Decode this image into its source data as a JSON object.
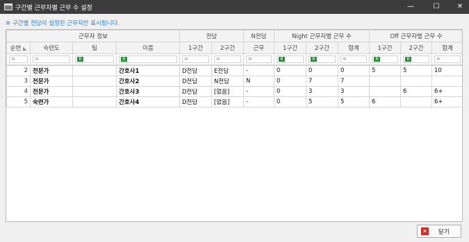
{
  "window": {
    "title": "구간별 근무자별 근무 수 설정",
    "min": "—",
    "max": "☐",
    "close": "✕"
  },
  "notice": "※ 구간별 전담이 설정된 근무자만 표시됩니다.",
  "groups": [
    "근무자 정보",
    "전담",
    "N전담",
    "Night 근무자별 근무 수",
    "Off 근무자별 근무 수"
  ],
  "columns": [
    "순번",
    "숙련도",
    "팀",
    "이름",
    "1구간",
    "2구간",
    "근무",
    "1구간",
    "2구간",
    "합계",
    "1구간",
    "2구간",
    "합계"
  ],
  "filter": [
    "=",
    "=",
    "ꟷ",
    "ꟷ",
    "=",
    "=",
    "=",
    "ꟷ",
    "ꟷ",
    "=",
    "ꟷ",
    "ꟷ",
    "="
  ],
  "rows": [
    [
      "2",
      "전문가",
      "",
      "간호사1",
      "D전담",
      "E전담",
      "-",
      "0",
      "0",
      "0",
      "5",
      "5",
      "10"
    ],
    [
      "3",
      "전문가",
      "",
      "간호사2",
      "D전담",
      "N전담",
      "N",
      "0",
      "7",
      "7",
      "",
      "",
      ""
    ],
    [
      "4",
      "전문가",
      "",
      "간호사3",
      "D전담",
      "[없음]",
      "-",
      "0",
      "3",
      "3",
      "",
      "6",
      "6+"
    ],
    [
      "5",
      "숙련가",
      "",
      "간호사4",
      "D전담",
      "[없음]",
      "-",
      "0",
      "5",
      "5",
      "6",
      "",
      "6+"
    ]
  ],
  "close_button": "닫기"
}
